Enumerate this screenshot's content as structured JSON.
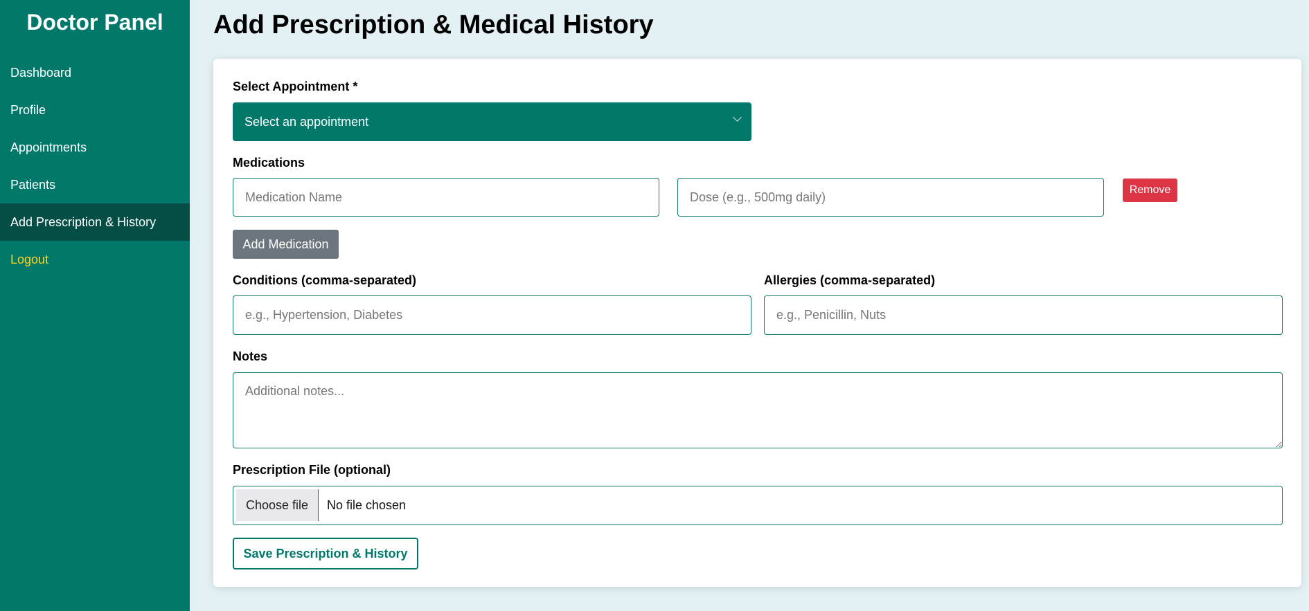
{
  "sidebar": {
    "brand": "Doctor Panel",
    "items": [
      {
        "label": "Dashboard"
      },
      {
        "label": "Profile"
      },
      {
        "label": "Appointments"
      },
      {
        "label": "Patients"
      },
      {
        "label": "Add Prescription & History",
        "active": true
      },
      {
        "label": "Logout"
      }
    ]
  },
  "page": {
    "title": "Add Prescription & Medical History"
  },
  "form": {
    "appointment": {
      "label": "Select Appointment *",
      "selected": "Select an appointment"
    },
    "medications": {
      "label": "Medications",
      "name_placeholder": "Medication Name",
      "dose_placeholder": "Dose (e.g., 500mg daily)",
      "remove_label": "Remove",
      "add_label": "Add Medication"
    },
    "conditions": {
      "label": "Conditions (comma-separated)",
      "placeholder": "e.g., Hypertension, Diabetes"
    },
    "allergies": {
      "label": "Allergies (comma-separated)",
      "placeholder": "e.g., Penicillin, Nuts"
    },
    "notes": {
      "label": "Notes",
      "placeholder": "Additional notes..."
    },
    "file": {
      "label": "Prescription File (optional)",
      "button_label": "Choose file",
      "status": "No file chosen"
    },
    "submit_label": "Save Prescription & History"
  },
  "colors": {
    "primary": "#02786b",
    "sidebar_active": "#044e45",
    "logout": "#ffd21f",
    "remove": "#dc3545",
    "secondary": "#6c757d",
    "background": "#e3f1f4"
  }
}
